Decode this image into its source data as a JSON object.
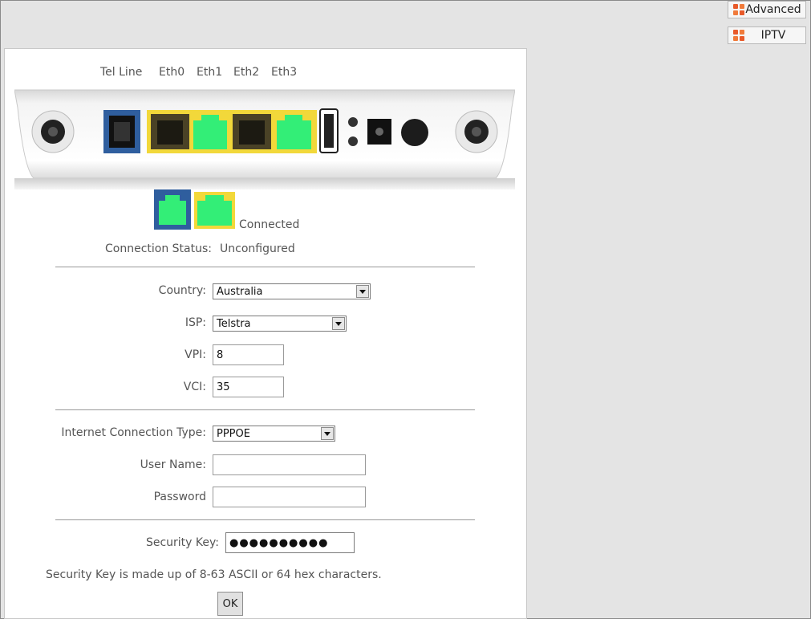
{
  "side_buttons": {
    "advanced": "Advanced",
    "iptv": "IPTV"
  },
  "ports": {
    "tel_line": "Tel Line",
    "eth0": "Eth0",
    "eth1": "Eth1",
    "eth2": "Eth2",
    "eth3": "Eth3"
  },
  "legend": {
    "connected": "Connected"
  },
  "status": {
    "label": "Connection Status:",
    "value": "Unconfigured"
  },
  "form": {
    "country_label": "Country:",
    "country_value": "Australia",
    "isp_label": "ISP:",
    "isp_value": "Telstra",
    "vpi_label": "VPI:",
    "vpi_value": "8",
    "vci_label": "VCI:",
    "vci_value": "35",
    "conn_type_label": "Internet Connection Type:",
    "conn_type_value": "PPPOE",
    "username_label": "User Name:",
    "username_value": "",
    "password_label": "Password",
    "password_value": "",
    "security_key_label": "Security Key:",
    "security_key_value": "●●●●●●●●●●",
    "security_note": "Security Key is made up of 8-63 ASCII or 64 hex characters.",
    "ok_label": "OK"
  },
  "colors": {
    "port_connected": "#33ee77",
    "port_eth_bg": "#f2d83a",
    "port_tel_bg": "#2f5e9e",
    "orange_icon": "#e85a2a"
  }
}
